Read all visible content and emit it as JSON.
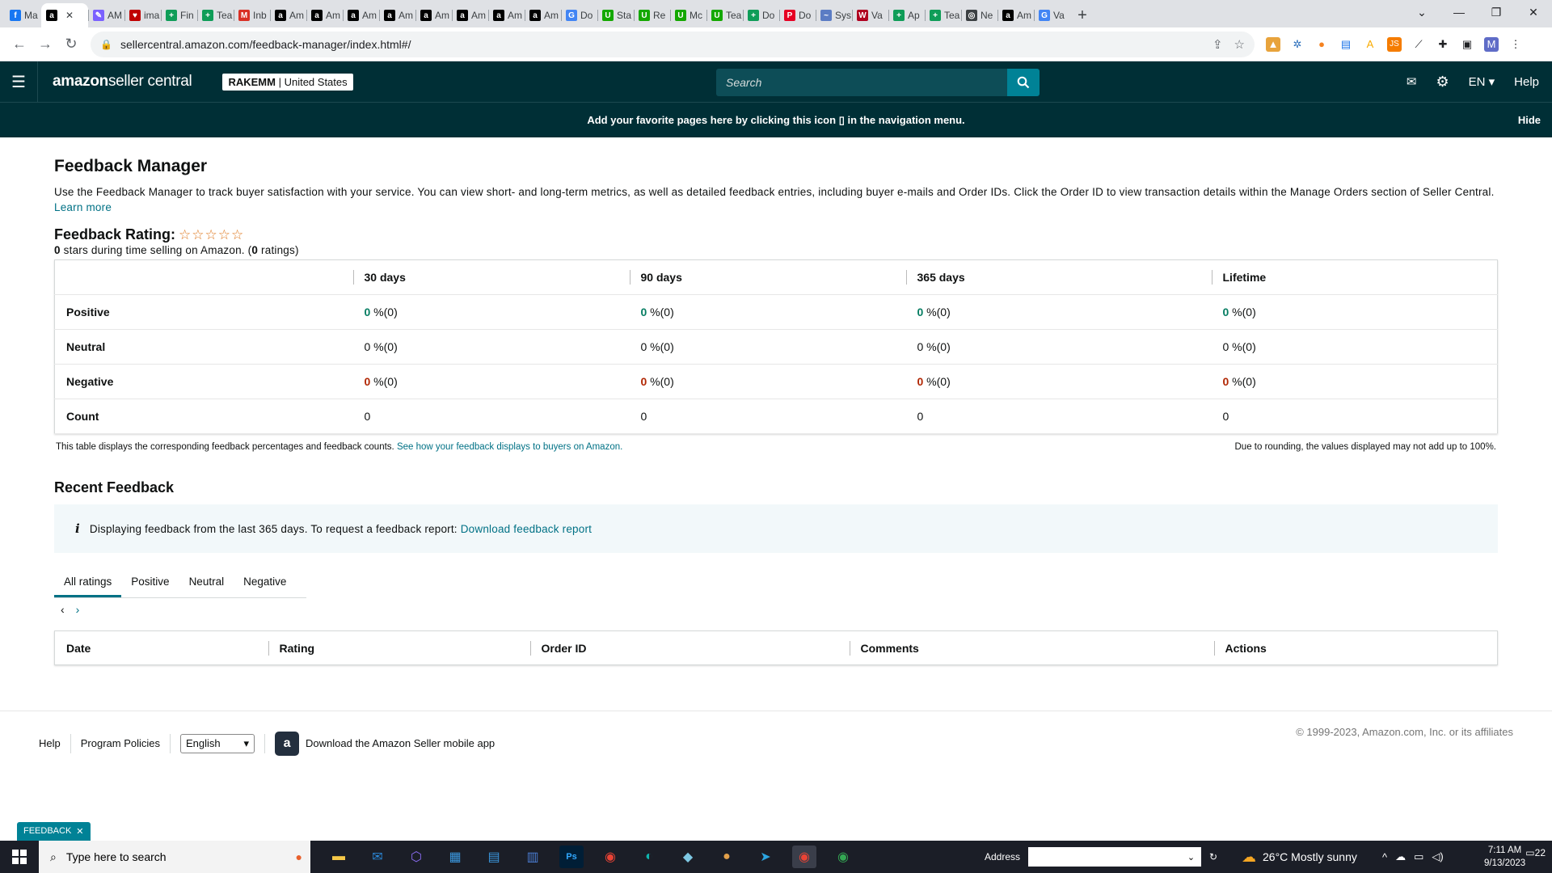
{
  "browser": {
    "tabs": [
      {
        "label": "Ma",
        "favicon": "facebook-icon",
        "color": "#1877f2",
        "glyph": "f"
      },
      {
        "label": "",
        "favicon": "amazon-icon",
        "color": "#000000",
        "glyph": "a",
        "active": true
      },
      {
        "label": "AM",
        "favicon": "pencil-icon",
        "color": "#7b61ff",
        "glyph": "✎"
      },
      {
        "label": "ima",
        "favicon": "heart-icon",
        "color": "#c00000",
        "glyph": "♥"
      },
      {
        "label": "Fin",
        "favicon": "sheets-icon",
        "color": "#0f9d58",
        "glyph": "+"
      },
      {
        "label": "Tea",
        "favicon": "sheets-icon",
        "color": "#0f9d58",
        "glyph": "+"
      },
      {
        "label": "Inb",
        "favicon": "gmail-icon",
        "color": "#d93025",
        "glyph": "M"
      },
      {
        "label": "Am",
        "favicon": "amazon-icon",
        "color": "#000000",
        "glyph": "a"
      },
      {
        "label": "Am",
        "favicon": "amazon-icon",
        "color": "#000000",
        "glyph": "a"
      },
      {
        "label": "Am",
        "favicon": "amazon-icon",
        "color": "#000000",
        "glyph": "a"
      },
      {
        "label": "Am",
        "favicon": "amazon-icon",
        "color": "#000000",
        "glyph": "a"
      },
      {
        "label": "Am",
        "favicon": "amazon-icon",
        "color": "#000000",
        "glyph": "a"
      },
      {
        "label": "Am",
        "favicon": "amazon-icon",
        "color": "#000000",
        "glyph": "a"
      },
      {
        "label": "Am",
        "favicon": "amazon-icon",
        "color": "#000000",
        "glyph": "a"
      },
      {
        "label": "Am",
        "favicon": "amazon-icon",
        "color": "#000000",
        "glyph": "a"
      },
      {
        "label": "Do",
        "favicon": "google-icon",
        "color": "#4285f4",
        "glyph": "G"
      },
      {
        "label": "Sta",
        "favicon": "upwork-icon",
        "color": "#14a800",
        "glyph": "U"
      },
      {
        "label": "Re",
        "favicon": "upwork-icon",
        "color": "#14a800",
        "glyph": "U"
      },
      {
        "label": "Mc",
        "favicon": "upwork-icon",
        "color": "#14a800",
        "glyph": "U"
      },
      {
        "label": "Tea",
        "favicon": "upwork-icon",
        "color": "#14a800",
        "glyph": "U"
      },
      {
        "label": "Do",
        "favicon": "sheets-icon",
        "color": "#0f9d58",
        "glyph": "+"
      },
      {
        "label": "Do",
        "favicon": "pinterest-icon",
        "color": "#e60023",
        "glyph": "P"
      },
      {
        "label": "Sys",
        "favicon": "generic-icon",
        "color": "#5b7cc4",
        "glyph": "~"
      },
      {
        "label": "Va",
        "favicon": "w-icon",
        "color": "#b00020",
        "glyph": "W"
      },
      {
        "label": "Ap",
        "favicon": "sheets-icon",
        "color": "#0f9d58",
        "glyph": "+"
      },
      {
        "label": "Tea",
        "favicon": "sheets-icon",
        "color": "#0f9d58",
        "glyph": "+"
      },
      {
        "label": "Ne",
        "favicon": "globe-icon",
        "color": "#3c4043",
        "glyph": "◎"
      },
      {
        "label": "Am",
        "favicon": "amazon-icon",
        "color": "#000000",
        "glyph": "a"
      },
      {
        "label": "Va",
        "favicon": "google-icon",
        "color": "#4285f4",
        "glyph": "G"
      }
    ],
    "url": "sellercentral.amazon.com/feedback-manager/index.html#/"
  },
  "header": {
    "logo_bold": "amazon",
    "logo_rest": " seller central",
    "account_name": "RAKEMM",
    "account_sep": " | ",
    "account_region": "United States",
    "search_placeholder": "Search",
    "lang": "EN",
    "help": "Help",
    "banner_pre": "Add your favorite pages here by clicking this icon",
    "banner_post": "in the navigation menu.",
    "banner_hide": "Hide"
  },
  "page": {
    "title": "Feedback Manager",
    "intro": "Use the Feedback Manager to track buyer satisfaction with your service. You can view short- and long-term metrics, as well as detailed feedback entries, including buyer e-mails and Order IDs. Click the Order ID to view transaction details within the Manage Orders section of Seller Central.",
    "learn_more": "Learn more",
    "rating_label": "Feedback Rating:",
    "rating_stars": "☆☆☆☆☆",
    "rating_value": "0",
    "rating_text_mid": " stars during time selling on Amazon. (",
    "rating_count": "0",
    "rating_text_end": " ratings)",
    "table": {
      "columns": [
        "",
        "30 days",
        "90 days",
        "365 days",
        "Lifetime"
      ],
      "rows": [
        {
          "label": "Positive",
          "cells": [
            [
              "0",
              " %(0)"
            ],
            [
              "0",
              " %(0)"
            ],
            [
              "0",
              " %(0)"
            ],
            [
              "0",
              " %(0)"
            ]
          ]
        },
        {
          "label": "Neutral",
          "cells": [
            [
              "0",
              " %(0)"
            ],
            [
              "0",
              " %(0)"
            ],
            [
              "0",
              " %(0)"
            ],
            [
              "0",
              " %(0)"
            ]
          ]
        },
        {
          "label": "Negative",
          "cells": [
            [
              "0",
              " %(0)"
            ],
            [
              "0",
              " %(0)"
            ],
            [
              "0",
              " %(0)"
            ],
            [
              "0",
              " %(0)"
            ]
          ]
        },
        {
          "label": "Count",
          "cells": [
            [
              "0",
              ""
            ],
            [
              "0",
              ""
            ],
            [
              "0",
              ""
            ],
            [
              "0",
              ""
            ]
          ]
        }
      ]
    },
    "table_note": "This table displays the corresponding feedback percentages and feedback counts.",
    "table_note_link": "See how your feedback displays to buyers on Amazon.",
    "rounding_note": "Due to rounding, the values displayed may not add up to 100%.",
    "recent_title": "Recent Feedback",
    "info_text": "Displaying feedback from the last 365 days. To request a feedback report:",
    "info_link": "Download feedback report",
    "tabs": [
      "All ratings",
      "Positive",
      "Neutral",
      "Negative"
    ],
    "recent_columns": [
      "Date",
      "Rating",
      "Order ID",
      "Comments",
      "Actions"
    ]
  },
  "footer": {
    "help": "Help",
    "policies": "Program Policies",
    "language": "English",
    "app_text": "Download the Amazon Seller mobile app",
    "copyright": "© 1999-2023, Amazon.com, Inc. or its affiliates",
    "feedback_tab": "FEEDBACK"
  },
  "taskbar": {
    "search_placeholder": "Type here to search",
    "address_label": "Address",
    "weather": "26°C  Mostly sunny",
    "time": "7:11 AM",
    "date": "9/13/2023",
    "notifications": "22"
  },
  "colors": {
    "header_bg": "#002f36",
    "accent": "#008296",
    "positive": "#067d62",
    "negative": "#b12704",
    "link": "#007185"
  }
}
